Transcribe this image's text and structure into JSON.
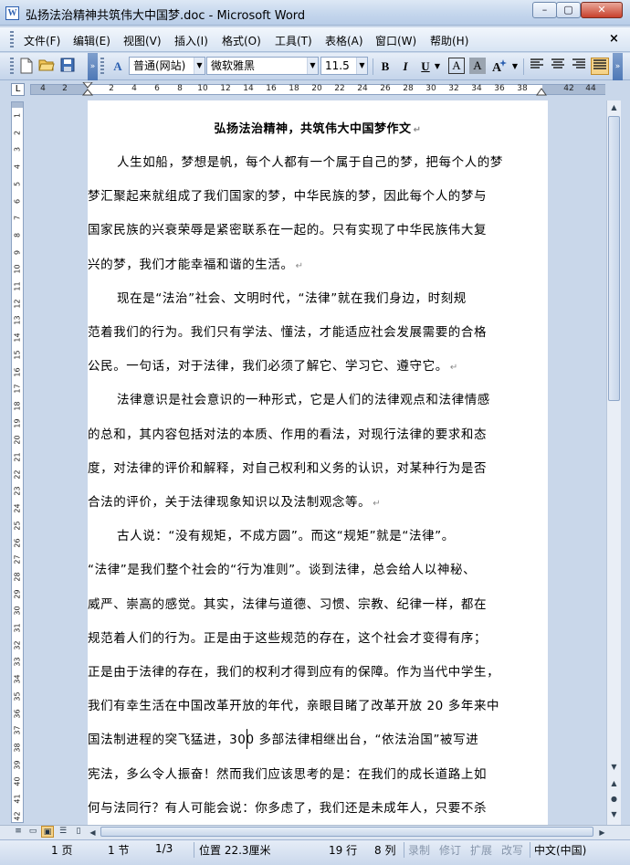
{
  "window": {
    "title_doc": "弘扬法治精神共筑伟大中国梦.doc",
    "title_app": "Microsoft Word",
    "icon": "word-doc-icon",
    "min_label": "–",
    "max_label": "▢",
    "close_label": "✕"
  },
  "menu": {
    "items": [
      "文件(F)",
      "编辑(E)",
      "视图(V)",
      "插入(I)",
      "格式(O)",
      "工具(T)",
      "表格(A)",
      "窗口(W)",
      "帮助(H)"
    ],
    "doc_close": "×"
  },
  "toolbar": {
    "style": "普通(网站)",
    "font": "微软雅黑",
    "size": "11.5",
    "bold": "B",
    "italic": "I",
    "underline": "U",
    "border_a": "A",
    "shade_a": "A",
    "style_icon_label": "A"
  },
  "ruler": {
    "tab_marker": "L",
    "h_ticks": [
      "4",
      "2",
      "2",
      "4",
      "6",
      "8",
      "10",
      "12",
      "14",
      "16",
      "18",
      "20",
      "22",
      "24",
      "26",
      "28",
      "30",
      "32",
      "34",
      "36",
      "38",
      "42",
      "44"
    ],
    "v_ticks": [
      "1",
      "2",
      "3",
      "4",
      "5",
      "6",
      "7",
      "8",
      "9",
      "10",
      "11",
      "12",
      "13",
      "14",
      "15",
      "16",
      "17",
      "18",
      "19",
      "20",
      "21",
      "22",
      "23",
      "24",
      "25",
      "26",
      "27",
      "28",
      "29",
      "30",
      "31",
      "32",
      "33",
      "34",
      "35",
      "36",
      "37",
      "38",
      "39",
      "40",
      "41",
      "42"
    ]
  },
  "document": {
    "title": "弘扬法治精神，共筑伟大中国梦作文",
    "lines": [
      {
        "text": "人生如船，梦想是帆，每个人都有一个属于自己的梦，把每个人的梦",
        "indent": true,
        "mark": false
      },
      {
        "text": "梦汇聚起来就组成了我们国家的梦，中华民族的梦，因此每个人的梦与",
        "indent": false,
        "mark": false
      },
      {
        "text": "国家民族的兴衰荣辱是紧密联系在一起的。只有实现了中华民族伟大复",
        "indent": false,
        "mark": false
      },
      {
        "text": "兴的梦，我们才能幸福和谐的生活。",
        "indent": false,
        "mark": true
      },
      {
        "text": "现在是“法治”社会、文明时代，“法律”就在我们身边，时刻规",
        "indent": true,
        "mark": false
      },
      {
        "text": "范着我们的行为。我们只有学法、懂法，才能适应社会发展需要的合格",
        "indent": false,
        "mark": false
      },
      {
        "text": "公民。一句话，对于法律，我们必须了解它、学习它、遵守它。",
        "indent": false,
        "mark": true
      },
      {
        "text": "法律意识是社会意识的一种形式，它是人们的法律观点和法律情感",
        "indent": true,
        "mark": false
      },
      {
        "text": "的总和，其内容包括对法的本质、作用的看法，对现行法律的要求和态",
        "indent": false,
        "mark": false
      },
      {
        "text": "度，对法律的评价和解释，对自己权利和义务的认识，对某种行为是否",
        "indent": false,
        "mark": false
      },
      {
        "text": "合法的评价，关于法律现象知识以及法制观念等。",
        "indent": false,
        "mark": true
      },
      {
        "text": "古人说：“没有规矩，不成方圆”。而这“规矩”就是“法律”。",
        "indent": true,
        "mark": false
      },
      {
        "text": "“法律”是我们整个社会的“行为准则”。谈到法律，总会给人以神秘、",
        "indent": false,
        "mark": false
      },
      {
        "text": "威严、崇高的感觉。其实，法律与道德、习惯、宗教、纪律一样，都在",
        "indent": false,
        "mark": false
      },
      {
        "text": "规范着人们的行为。正是由于这些规范的存在，这个社会才变得有序；",
        "indent": false,
        "mark": false
      },
      {
        "text": "正是由于法律的存在，我们的权利才得到应有的保障。作为当代中学生，",
        "indent": false,
        "mark": false
      },
      {
        "text": "我们有幸生活在中国改革开放的年代，亲眼目睹了改革开放 20 多年来中",
        "indent": false,
        "mark": false
      },
      {
        "text": "国法制进程的突飞猛进，300 多部法律相继出台，“依法治国”被写进",
        "indent": false,
        "mark": false
      },
      {
        "text": "宪法，多么令人振奋！然而我们应该思考的是：在我们的成长道路上如",
        "indent": false,
        "mark": false
      },
      {
        "text": "何与法同行？有人可能会说：你多虑了，我们还是未成年人，只要不杀",
        "indent": false,
        "mark": false
      }
    ],
    "paragraph_mark": "↵"
  },
  "status": {
    "page": "1 页",
    "section": "1 节",
    "pages": "1/3",
    "position": "位置 22.3厘米",
    "row": "19 行",
    "col": "8 列",
    "rec": "录制",
    "trk": "修订",
    "ext": "扩展",
    "ovr": "改写",
    "lang": "中文(中国)"
  }
}
